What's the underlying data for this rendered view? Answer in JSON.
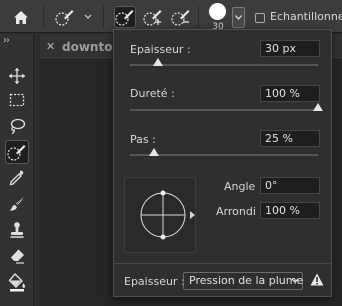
{
  "options_bar": {
    "brush_size_value": "30",
    "sample_all_layers_label": "Echantillonner t"
  },
  "document_tab": {
    "close_glyph": "✕",
    "title": "downtown"
  },
  "tools_panel": {
    "collapse_glyph": "››",
    "tools": [
      "move-icon",
      "marquee-icon",
      "lasso-icon",
      "quick-selection-icon",
      "eyedropper-icon",
      "brush-icon",
      "stamp-icon",
      "eraser-icon",
      "paint-bucket-icon"
    ],
    "selected_tool": "quick-selection-icon"
  },
  "brush_popup": {
    "size_label": "Epaisseur :",
    "size_value": "30 px",
    "size_level_percent": 15,
    "hardness_label": "Dureté :",
    "hardness_value": "100 %",
    "hardness_level_percent": 100,
    "spacing_label": "Pas :",
    "spacing_value": "25 %",
    "spacing_level_percent": 13,
    "angle_label": "Angle :",
    "angle_value": "0°",
    "roundness_label": "Arrondi :",
    "roundness_value": "100 %",
    "pressure_label": "Epaisseur :",
    "pressure_option": "Pression de la plume"
  },
  "colors": {
    "background": "#2b2b2b",
    "panel": "#323232",
    "popup": "#2f2f2f",
    "field": "#1e1e1e",
    "text": "#d6d6d6"
  }
}
